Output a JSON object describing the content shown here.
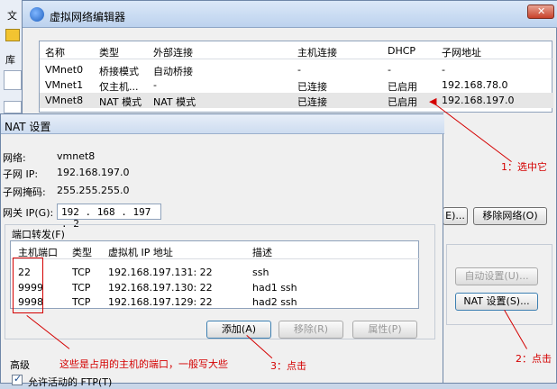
{
  "bg": {
    "menu_label": "文",
    "left_label": "库"
  },
  "window": {
    "title": "虚拟网络编辑器"
  },
  "netlist": {
    "headers": [
      "名称",
      "类型",
      "外部连接",
      "主机连接",
      "DHCP",
      "子网地址"
    ],
    "rows": [
      [
        "VMnet0",
        "桥接模式",
        "自动桥接",
        "-",
        "-",
        "-"
      ],
      [
        "VMnet1",
        "仅主机...",
        "-",
        "已连接",
        "已启用",
        "192.168.78.0"
      ],
      [
        "VMnet8",
        "NAT 模式",
        "NAT 模式",
        "已连接",
        "已启用",
        "192.168.197.0"
      ]
    ]
  },
  "right_buttons": {
    "edit_partial": "E)...",
    "remove_network": "移除网络(O)",
    "auto_settings": "自动设置(U)...",
    "nat_settings": "NAT 设置(S)..."
  },
  "nat": {
    "title": "NAT 设置",
    "network_label": "网络:",
    "network_value": "vmnet8",
    "subnet_ip_label": "子网 IP:",
    "subnet_ip_value": "192.168.197.0",
    "subnet_mask_label": "子网掩码:",
    "subnet_mask_value": "255.255.255.0",
    "gateway_label": "网关 IP(G):",
    "gateway_value": "192 . 168 . 197 .  2",
    "port_forward_label": "端口转发(F)",
    "pf_headers": [
      "主机端口",
      "类型",
      "虚拟机 IP 地址",
      "描述"
    ],
    "pf_rows": [
      [
        "22",
        "TCP",
        "192.168.197.131: 22",
        "ssh"
      ],
      [
        "9999",
        "TCP",
        "192.168.197.130: 22",
        "had1 ssh"
      ],
      [
        "9998",
        "TCP",
        "192.168.197.129: 22",
        "had2 ssh"
      ]
    ],
    "add_button": "添加(A)",
    "remove_button": "移除(R)",
    "properties_button": "属性(P)",
    "advanced_label": "高级",
    "allow_ftp_label": "允许活动的 FTP(T)"
  },
  "annotations": {
    "select_it": "1：选中它",
    "click_2": "2：点击",
    "click_3": "3：点击",
    "ports_note": "这些是占用的主机的端口，一般写大些"
  }
}
